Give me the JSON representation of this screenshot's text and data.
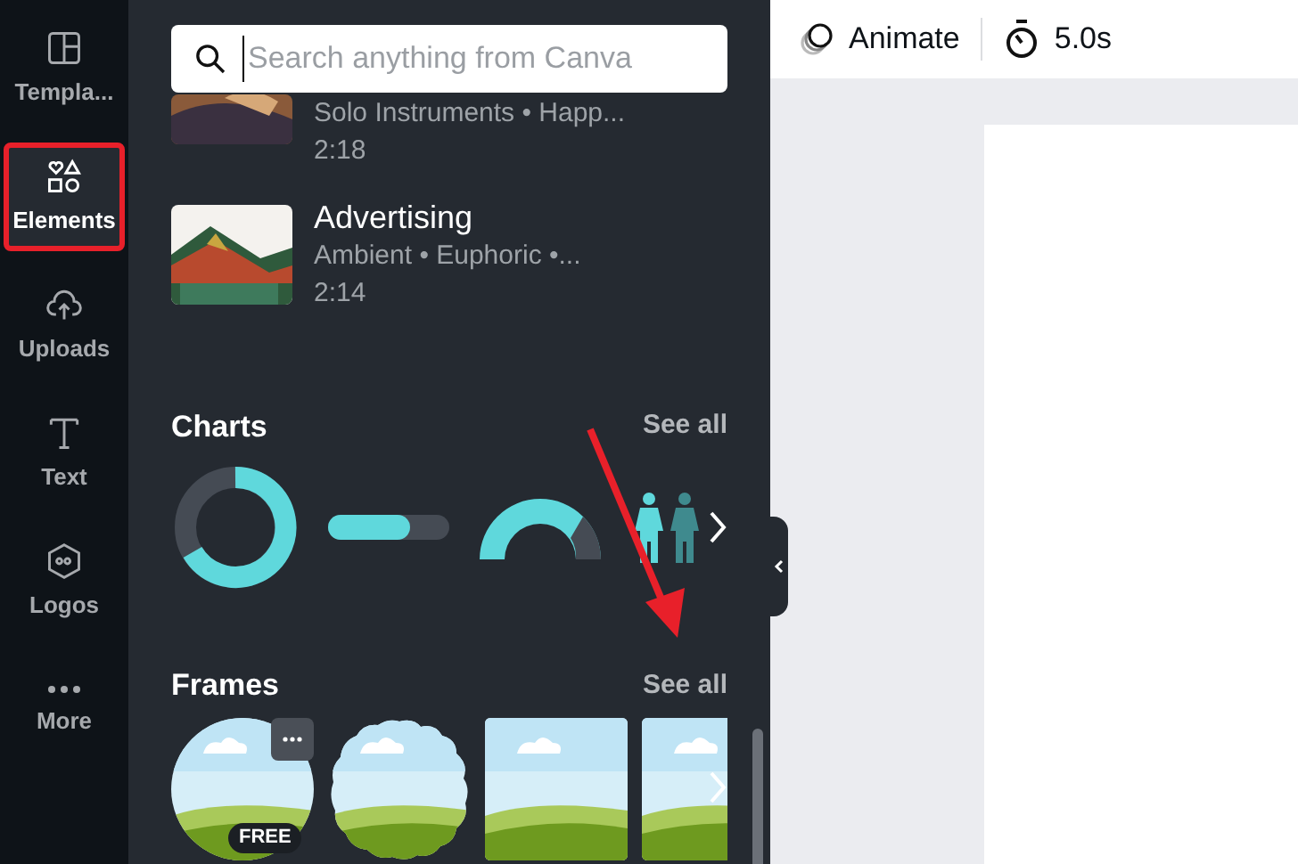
{
  "sidebar": {
    "items": [
      {
        "kind": "templates",
        "label": "Templa...",
        "selected": false
      },
      {
        "kind": "elements",
        "label": "Elements",
        "selected": true
      },
      {
        "kind": "uploads",
        "label": "Uploads",
        "selected": false
      },
      {
        "kind": "text",
        "label": "Text",
        "selected": false
      },
      {
        "kind": "logos",
        "label": "Logos",
        "selected": false
      },
      {
        "kind": "more",
        "label": "More",
        "selected": false
      }
    ]
  },
  "search": {
    "placeholder": "Search anything from Canva"
  },
  "audio_tracks": [
    {
      "tags": "Solo Instruments • Happ...",
      "duration": "2:18"
    },
    {
      "title": "Advertising",
      "tags": "Ambient • Euphoric •...",
      "duration": "2:14"
    }
  ],
  "sections": [
    {
      "kind": "charts",
      "title": "Charts",
      "see_all": "See all"
    },
    {
      "kind": "frames",
      "title": "Frames",
      "see_all": "See all",
      "badge": "FREE"
    }
  ],
  "toolbar": {
    "animate": "Animate",
    "duration": "5.0s"
  }
}
